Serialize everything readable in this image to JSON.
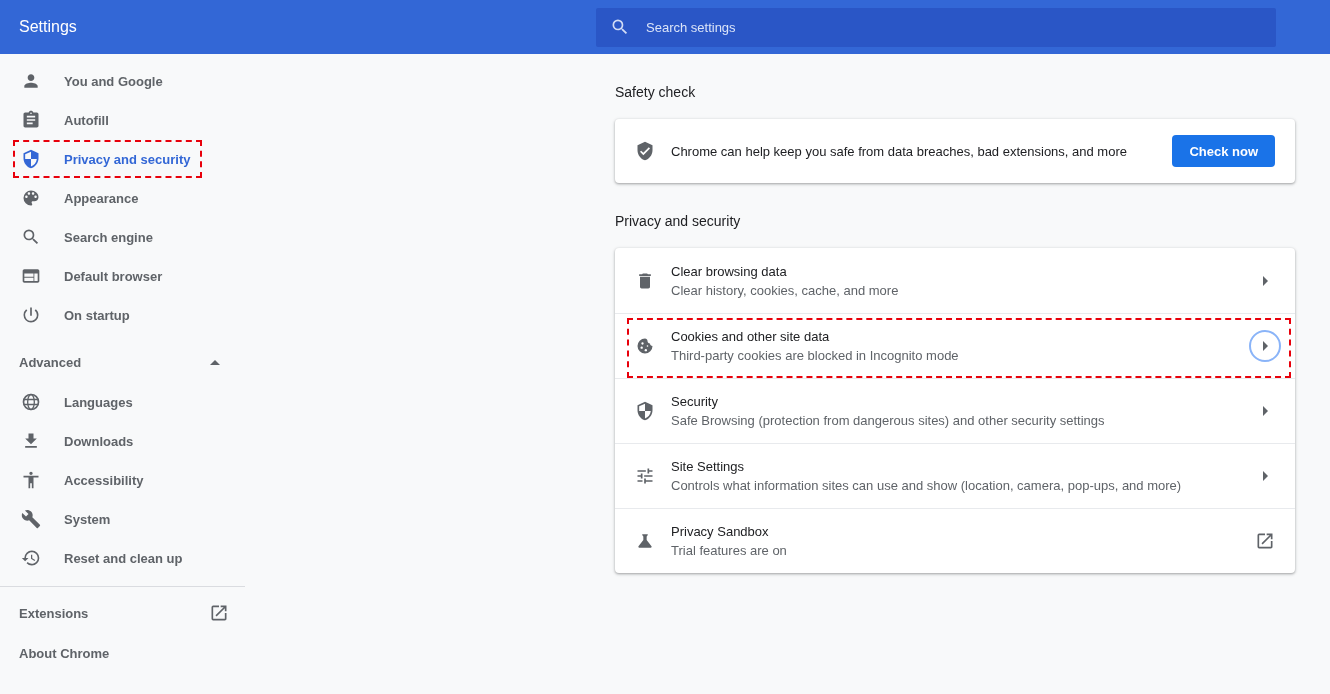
{
  "header": {
    "title": "Settings",
    "search": {
      "placeholder": "Search settings"
    }
  },
  "sidebar": {
    "items": [
      {
        "label": "You and Google",
        "selected": false,
        "highlighted": false
      },
      {
        "label": "Autofill",
        "selected": false,
        "highlighted": false
      },
      {
        "label": "Privacy and security",
        "selected": true,
        "highlighted": true
      },
      {
        "label": "Appearance",
        "selected": false,
        "highlighted": false
      },
      {
        "label": "Search engine",
        "selected": false,
        "highlighted": false
      },
      {
        "label": "Default browser",
        "selected": false,
        "highlighted": false
      },
      {
        "label": "On startup",
        "selected": false,
        "highlighted": false
      }
    ],
    "advanced": {
      "label": "Advanced",
      "expanded": true,
      "items": [
        {
          "label": "Languages",
          "selected": false,
          "highlighted": false
        },
        {
          "label": "Downloads",
          "selected": false,
          "highlighted": false
        },
        {
          "label": "Accessibility",
          "selected": false,
          "highlighted": false
        },
        {
          "label": "System",
          "selected": false,
          "highlighted": false
        },
        {
          "label": "Reset and clean up",
          "selected": false,
          "highlighted": false
        }
      ]
    },
    "footer_links": [
      {
        "label": "Extensions",
        "kind": "external"
      },
      {
        "label": "About Chrome",
        "kind": "plain"
      }
    ]
  },
  "safety_check": {
    "title": "Safety check",
    "text": "Chrome can help keep you safe from data breaches, bad extensions, and more",
    "button": "Check now"
  },
  "privacy": {
    "title": "Privacy and security",
    "rows": [
      {
        "title": "Clear browsing data",
        "subtitle": "Clear history, cookies, cache, and more",
        "kind": "arrow",
        "highlighted": false,
        "focused": false
      },
      {
        "title": "Cookies and other site data",
        "subtitle": "Third-party cookies are blocked in Incognito mode",
        "kind": "arrow",
        "highlighted": true,
        "focused": true
      },
      {
        "title": "Security",
        "subtitle": "Safe Browsing (protection from dangerous sites) and other security settings",
        "kind": "arrow",
        "highlighted": false,
        "focused": false
      },
      {
        "title": "Site Settings",
        "subtitle": "Controls what information sites can use and show (location, camera, pop-ups, and more)",
        "kind": "arrow",
        "highlighted": false,
        "focused": false
      },
      {
        "title": "Privacy Sandbox",
        "subtitle": "Trial features are on",
        "kind": "external",
        "highlighted": false,
        "focused": false
      }
    ]
  }
}
